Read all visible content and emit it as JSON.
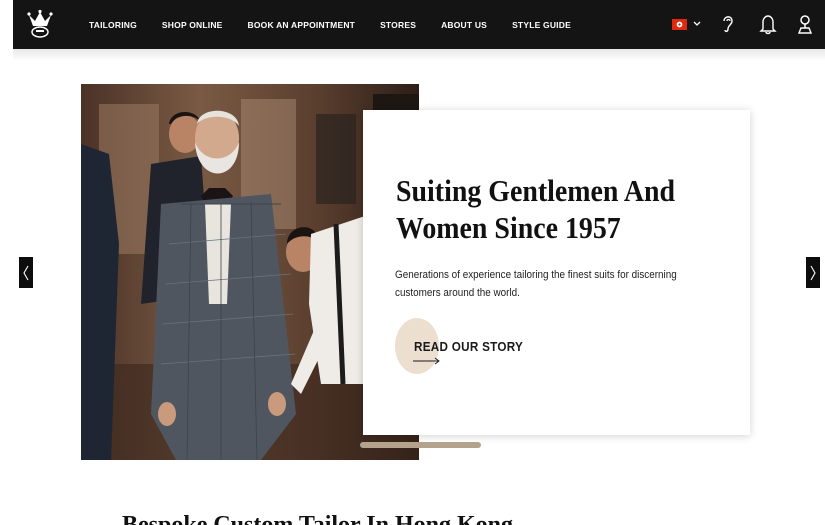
{
  "nav": {
    "items": [
      {
        "label": "TAILORING"
      },
      {
        "label": "SHOP ONLINE"
      },
      {
        "label": "BOOK AN APPOINTMENT"
      },
      {
        "label": "STORES"
      },
      {
        "label": "ABOUT US"
      },
      {
        "label": "STYLE GUIDE"
      }
    ],
    "language_flag": "hong-kong-flag-icon",
    "icons": [
      "crown-logo-icon",
      "chevron-down-icon",
      "ear-icon",
      "bell-icon",
      "location-pin-icon"
    ]
  },
  "hero": {
    "headline": "Suiting Gentlemen And Women Since 1957",
    "subtext": "Generations of experience tailoring the finest suits for discerning customers around the world.",
    "cta_label": "READ OUR STORY",
    "prev_icon": "chevron-left-icon",
    "next_icon": "chevron-right-icon"
  },
  "section": {
    "title": "Bespoke Custom Tailor In Hong Kong"
  },
  "colors": {
    "topbar": "#141414",
    "cta_circle": "#ecdfd0",
    "progress": "#b4a38c",
    "flag_red": "#de2910"
  }
}
